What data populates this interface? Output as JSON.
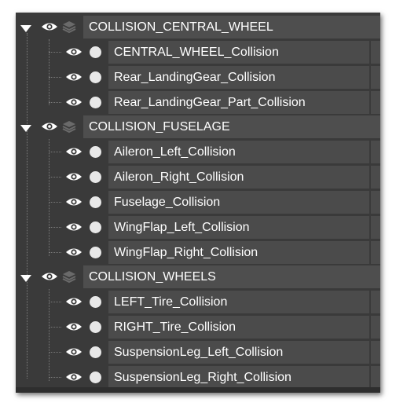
{
  "outliner": {
    "groups": [
      {
        "name": "COLLISION_CENTRAL_WHEEL",
        "items": [
          "CENTRAL_WHEEL_Collision",
          "Rear_LandingGear_Collision",
          "Rear_LandingGear_Part_Collision"
        ]
      },
      {
        "name": "COLLISION_FUSELAGE",
        "items": [
          "Aileron_Left_Collision",
          "Aileron_Right_Collision",
          "Fuselage_Collision",
          "WingFlap_Left_Collision",
          "WingFlap_Right_Collision"
        ]
      },
      {
        "name": "COLLISION_WHEELS",
        "items": [
          "LEFT_Tire_Collision",
          "RIGHT_Tire_Collision",
          "SuspensionLeg_Left_Collision",
          "SuspensionLeg_Right_Collision"
        ]
      }
    ]
  },
  "colors": {
    "panel": "#3a3a3a",
    "row": "#4b4b4b",
    "text": "#ffffff",
    "icon": "#e8e8e8"
  },
  "icons": {
    "expand": "triangle-down-icon",
    "visibility": "eye-icon",
    "layer": "layers-icon",
    "object": "circle-icon"
  }
}
